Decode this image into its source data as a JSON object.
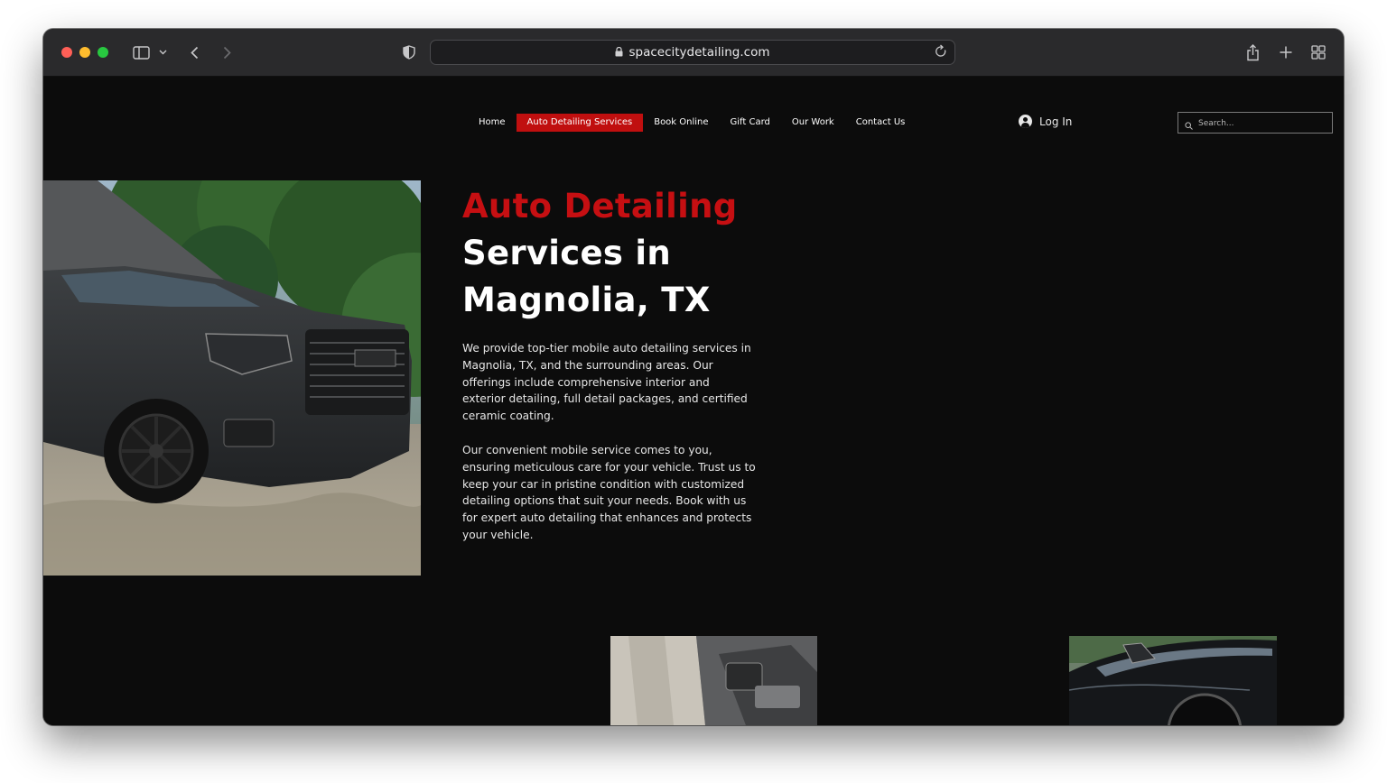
{
  "browser": {
    "url": "spacecitydetailing.com"
  },
  "nav": {
    "items": [
      {
        "label": "Home",
        "active": false
      },
      {
        "label": "Auto Detailing Services",
        "active": true
      },
      {
        "label": "Book Online",
        "active": false
      },
      {
        "label": "Gift Card",
        "active": false
      },
      {
        "label": "Our Work",
        "active": false
      },
      {
        "label": "Contact Us",
        "active": false
      }
    ],
    "login_label": "Log In",
    "search_placeholder": "Search..."
  },
  "hero": {
    "title_line1": "Auto Detailing",
    "title_line2": "Services in",
    "title_line3": "Magnolia, TX",
    "paragraph1": "We provide top-tier mobile auto detailing services in Magnolia, TX, and the surrounding areas. Our offerings include comprehensive interior and exterior detailing, full detail packages, and certified ceramic coating.",
    "paragraph2": "Our convenient mobile service comes to you, ensuring meticulous care for your vehicle. Trust us to keep your car in pristine condition with customized detailing options that suit your needs. Book with us for expert auto detailing that enhances and protects your vehicle."
  },
  "colors": {
    "accent": "#c60f12",
    "page_background": "#0c0c0c"
  }
}
